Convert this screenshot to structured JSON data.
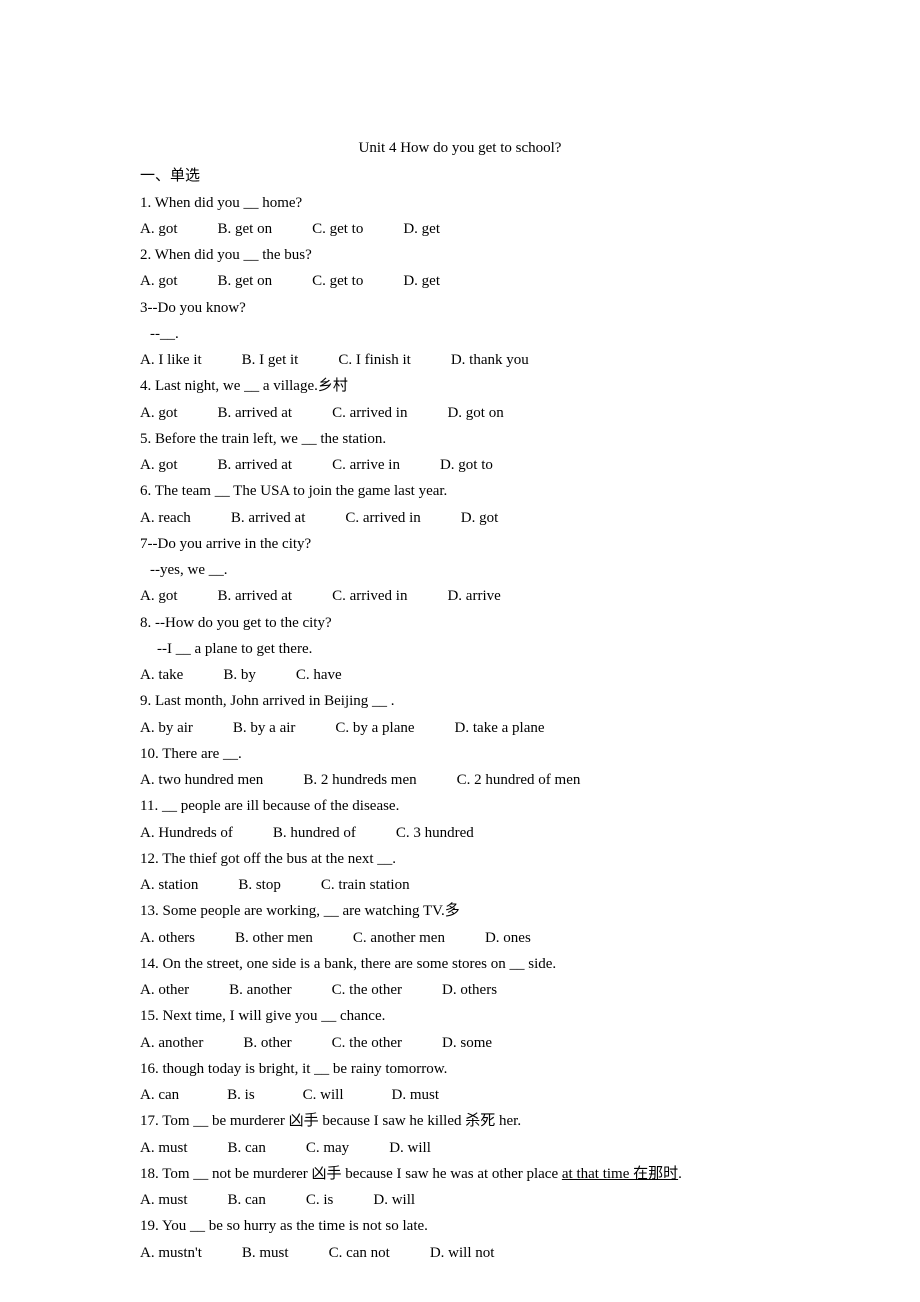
{
  "title": "Unit 4 How do you get to school?",
  "section_header": "一、单选",
  "questions": [
    {
      "prompt": "1. When did you __ home?",
      "opts": [
        "A. got",
        "B. get on",
        "C. get to",
        "D. get"
      ],
      "gap": "gap-m"
    },
    {
      "prompt": "2. When did you __ the bus?",
      "opts": [
        "A. got",
        "B. get on",
        "C. get to",
        "D. get"
      ],
      "gap": "gap-m"
    },
    {
      "prompt": "3--Do you know?",
      "sub": "--__.",
      "sub_class": "indent",
      "opts": [
        "A. I like it",
        "B. I get it",
        "C. I finish it",
        "D. thank you"
      ],
      "gap": "gap-m"
    },
    {
      "prompt": "4. Last night, we __ a village.乡村",
      "opts": [
        "A. got",
        "B. arrived at",
        "C. arrived in",
        "D. got on"
      ],
      "gap": "gap-m"
    },
    {
      "prompt": "5. Before the train left, we __ the station.",
      "opts": [
        "A. got",
        "B. arrived at",
        "C. arrive in",
        "D. got to"
      ],
      "gap": "gap-m"
    },
    {
      "prompt": "6. The team __ The USA to join the game last year.",
      "opts": [
        "A. reach",
        "B. arrived at",
        "C. arrived in",
        "D. got"
      ],
      "gap": "gap-m"
    },
    {
      "prompt": "7--Do you arrive in the city?",
      "sub": "--yes, we __.",
      "sub_class": "indent",
      "opts": [
        "A. got",
        "B. arrived at",
        "C. arrived in",
        "D. arrive"
      ],
      "gap": "gap-m"
    },
    {
      "prompt": "8. --How do you get to the city?",
      "sub": "--I __ a plane to get there.",
      "sub_class": "indent2",
      "opts": [
        "A. take",
        "B. by",
        "C. have"
      ],
      "gap": "gap-m"
    },
    {
      "prompt": "9. Last month, John arrived in Beijing __ .",
      "opts": [
        "A. by air",
        "B. by a air",
        "C. by a plane",
        "D. take a plane"
      ],
      "gap": "gap-m"
    },
    {
      "prompt": "10. There are __.",
      "opts": [
        "A. two hundred men",
        "B. 2 hundreds men",
        "C. 2 hundred of men"
      ],
      "gap": "gap-m"
    },
    {
      "prompt": "11. __ people are ill because of the disease.",
      "opts": [
        "A. Hundreds of",
        "B. hundred of",
        "C. 3 hundred"
      ],
      "gap": "gap-m"
    },
    {
      "prompt": "12. The thief got off the bus at the next __.",
      "opts": [
        "A. station",
        "B. stop",
        "C. train station"
      ],
      "gap": "gap-m"
    },
    {
      "prompt": "13. Some people are working, __ are watching TV.多",
      "opts": [
        "A. others",
        "B. other men",
        "C. another men",
        "D. ones"
      ],
      "gap": "gap-m"
    },
    {
      "prompt": "14. On the street, one side is a bank, there are some stores on __ side.",
      "opts": [
        "A. other",
        "B. another",
        "C. the other",
        "D. others"
      ],
      "gap": "gap-m"
    },
    {
      "prompt": "15. Next time, I will give you __ chance.",
      "opts": [
        "A. another",
        "B. other",
        "C. the other",
        "D. some"
      ],
      "gap": "gap-m"
    },
    {
      "prompt": "16. though today is bright, it __ be rainy tomorrow.",
      "opts": [
        "A. can",
        "B. is",
        "C. will",
        "D. must"
      ],
      "gap": "gap-l"
    },
    {
      "prompt": "17. Tom __ be murderer 凶手  because I saw he killed 杀死  her.",
      "opts": [
        "A. must",
        "B. can",
        "C. may",
        "D. will"
      ],
      "gap": "gap-m"
    },
    {
      "prompt_html": "18. Tom __ not be murderer 凶手  because I saw he was at other place <u>at that time 在那时</u>.",
      "opts": [
        "A. must",
        "B. can",
        "C. is",
        "D. will"
      ],
      "gap": "gap-m"
    },
    {
      "prompt": "19. You __ be so hurry as the time is not so late.",
      "opts": [
        "A. mustn't",
        "B. must",
        "C. can not",
        "D. will not"
      ],
      "gap": "gap-m"
    }
  ]
}
